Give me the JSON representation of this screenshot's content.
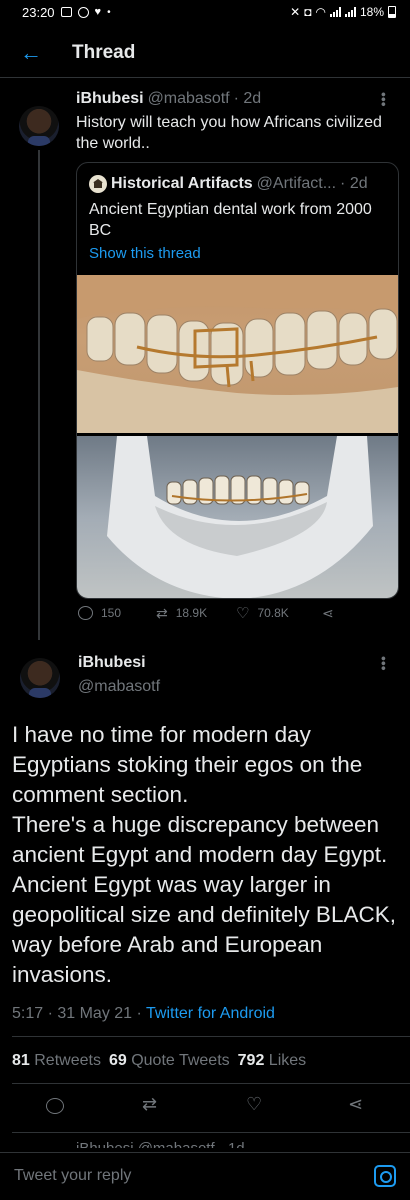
{
  "status_bar": {
    "time": "23:20",
    "battery": "18%"
  },
  "header": {
    "title": "Thread"
  },
  "tweet1": {
    "display_name": "iBhubesi",
    "handle": "@mabasotf",
    "time": "· 2d",
    "text": "History will teach you how Africans civilized the world..",
    "quoted": {
      "display_name": "Historical Artifacts",
      "handle": "@Artifact...",
      "time": "· 2d",
      "text": "Ancient Egyptian dental work from 2000 BC",
      "link": "Show this thread"
    },
    "counts": {
      "replies": "150",
      "retweets": "18.9K",
      "likes": "70.8K"
    }
  },
  "tweet2": {
    "display_name": "iBhubesi",
    "handle": "@mabasotf",
    "text": "I have no time for modern day Egyptians stoking their egos on the comment section.\nThere's a huge discrepancy between ancient Egypt and modern day Egypt. Ancient Egypt was way larger in geopolitical size and definitely BLACK, way before Arab  and European invasions.",
    "timestamp": "5:17 · 31 May 21 · ",
    "source": "Twitter for Android",
    "stats": {
      "retweets_count": "81",
      "retweets_label": "Retweets",
      "quotes_count": "69",
      "quotes_label": "Quote Tweets",
      "likes_count": "792",
      "likes_label": "Likes"
    }
  },
  "next_reply_peek": "iBhubesi @mabasotf · 1d",
  "reply_bar": {
    "placeholder": "Tweet your reply"
  }
}
